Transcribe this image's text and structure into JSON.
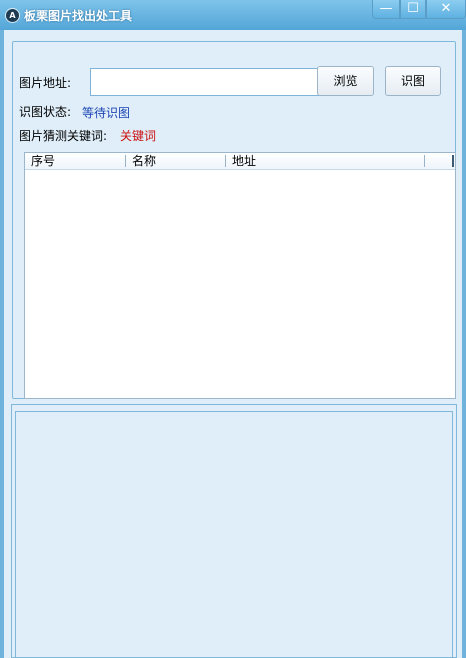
{
  "window": {
    "title": "板栗图片找出处工具",
    "icon_glyph": "A",
    "min_glyph": "—",
    "max_glyph": "☐",
    "close_glyph": "✕"
  },
  "form": {
    "url_label": "图片地址:",
    "url_value": "",
    "browse_label": "浏览",
    "recognize_label": "识图",
    "status_label": "识图状态:",
    "status_value": "等待识图",
    "keyword_label": "图片猜测关键词:",
    "keyword_value": "关键词"
  },
  "list": {
    "columns": [
      "序号",
      "名称",
      "地址"
    ],
    "rows": []
  },
  "colors": {
    "status": "#1c45b5",
    "keyword": "#cc1010",
    "titlebar": "#5aaedd"
  }
}
